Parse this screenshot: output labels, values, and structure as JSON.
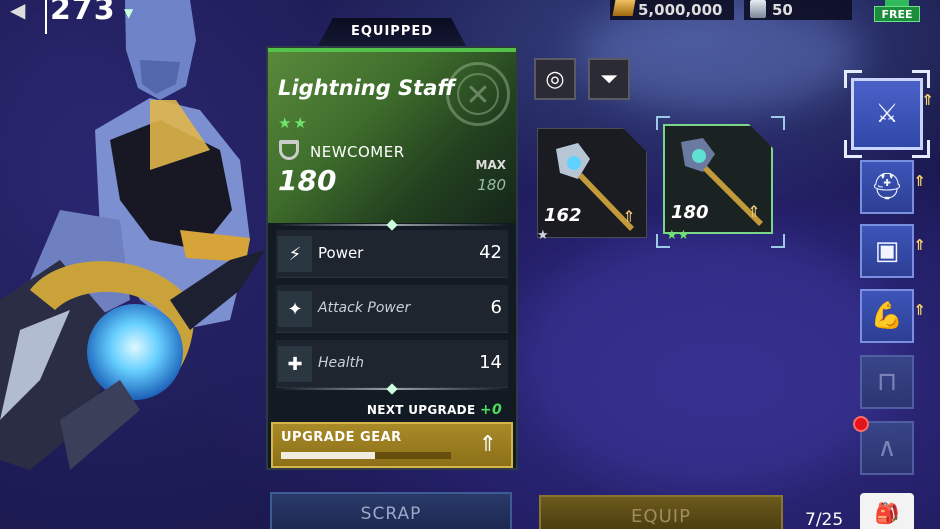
{
  "hud": {
    "counter": "273",
    "gold": "5,000,000",
    "silver": "50",
    "free_label": "FREE"
  },
  "card": {
    "tab_label": "EQUIPPED",
    "item_name": "Lightning Staff",
    "stars": "★★",
    "tier": "NEWCOMER",
    "level": "180",
    "max_label": "MAX",
    "max_value": "180",
    "stats": [
      {
        "icon": "lightning-icon",
        "label": "Power",
        "value": "42"
      },
      {
        "icon": "attack-power-icon",
        "label": "Attack Power",
        "value": "6"
      },
      {
        "icon": "health-icon",
        "label": "Health",
        "value": "14"
      }
    ],
    "next_upgrade_label": "NEXT UPGRADE",
    "next_upgrade_value": "+0",
    "upgrade_label": "UPGRADE GEAR",
    "upgrade_progress": 0.55
  },
  "gear_items": [
    {
      "level": "162",
      "stars": "★",
      "selected": false
    },
    {
      "level": "180",
      "stars": "★★",
      "selected": true
    }
  ],
  "slots": [
    {
      "name": "weapon-slot",
      "icon": "sword-icon",
      "upgradable": true
    },
    {
      "name": "helmet-slot",
      "icon": "helmet-icon",
      "upgradable": true
    },
    {
      "name": "armor-slot",
      "icon": "armor-icon",
      "upgradable": true
    },
    {
      "name": "arm-slot",
      "icon": "arm-icon",
      "upgradable": true
    },
    {
      "name": "legs-slot",
      "icon": "legs-icon",
      "upgradable": false
    },
    {
      "name": "boots-slot",
      "icon": "boots-icon",
      "upgradable": false
    }
  ],
  "buttons": {
    "scrap": "SCRAP",
    "equip": "EQUIP"
  },
  "inventory": {
    "count": "7/25"
  },
  "colors": {
    "accent_green": "#53c24a",
    "upgrade_gold": "#a88a28",
    "slot_blue": "#3d55b8"
  }
}
